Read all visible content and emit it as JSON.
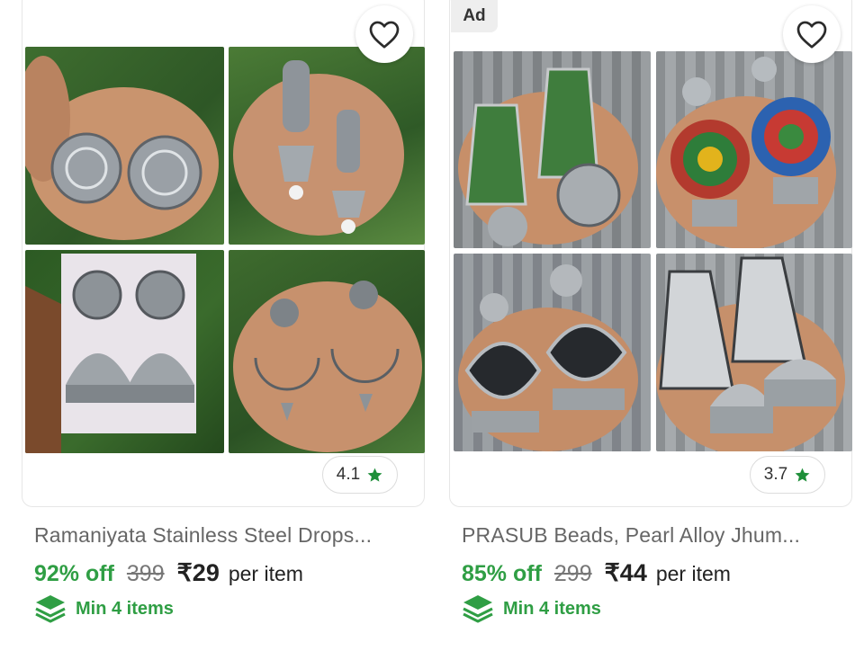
{
  "products": [
    {
      "ad": "",
      "rating": "4.1",
      "title": "Ramaniyata Stainless Steel Drops...",
      "discount": "92% off",
      "mrp": "399",
      "price": "₹29",
      "per": "per item",
      "min": "Min 4 items"
    },
    {
      "ad": "Ad",
      "rating": "3.7",
      "title": "PRASUB Beads, Pearl Alloy Jhum...",
      "discount": "85% off",
      "mrp": "299",
      "price": "₹44",
      "per": "per item",
      "min": "Min 4 items"
    }
  ],
  "colors": {
    "accent_green": "#2f9e44",
    "star_green": "#1f8f3a",
    "foliage": "#3f6b2f",
    "tile_stone": "#8b8d8f"
  },
  "icons": {
    "wishlist": "heart-outline-icon",
    "rating": "star-icon",
    "min_order": "layers-icon"
  }
}
